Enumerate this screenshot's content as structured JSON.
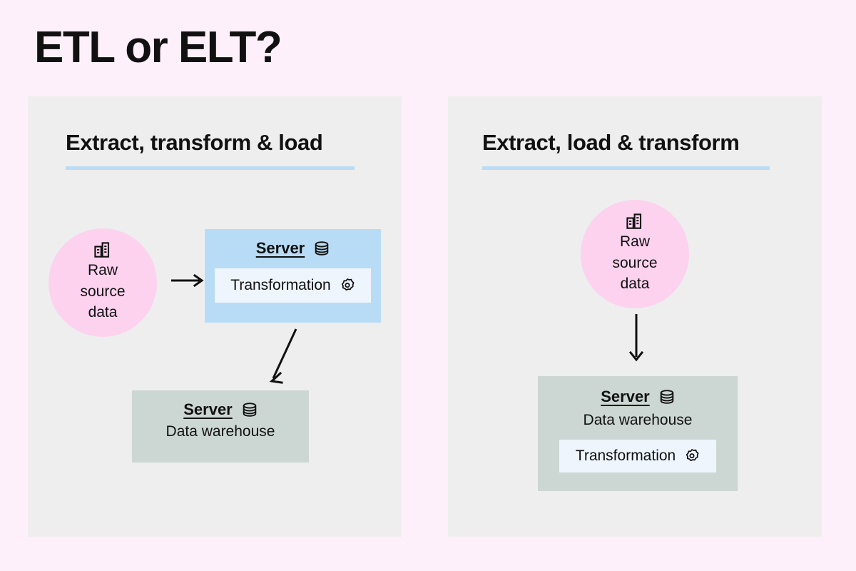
{
  "title": "ETL or ELT?",
  "colors": {
    "page_background": "#fdf0fa",
    "panel_background": "#eeeeee",
    "heading_underline": "#bcdcf5",
    "source_circle": "#fcd2ef",
    "server_blue": "#b8dcf5",
    "warehouse_grey": "#ccd6d2",
    "transform_chip": "#eef5fc",
    "text": "#111111"
  },
  "panels": [
    {
      "id": "etl",
      "heading": "Extract, transform & load",
      "source": {
        "icon": "building-icon",
        "lines": [
          "Raw",
          "source",
          "data"
        ]
      },
      "server": {
        "title": "Server",
        "title_icon": "database-icon",
        "transformation": {
          "label": "Transformation",
          "icon": "gear-icon"
        }
      },
      "warehouse": {
        "title": "Server",
        "title_icon": "database-icon",
        "subtitle": "Data warehouse"
      },
      "arrows": [
        "arrow-right",
        "arrow-diagonal-down-left"
      ]
    },
    {
      "id": "elt",
      "heading": "Extract, load & transform",
      "source": {
        "icon": "building-icon",
        "lines": [
          "Raw",
          "source",
          "data"
        ]
      },
      "warehouse": {
        "title": "Server",
        "title_icon": "database-icon",
        "subtitle": "Data warehouse",
        "transformation": {
          "label": "Transformation",
          "icon": "gear-icon"
        }
      },
      "arrows": [
        "arrow-down"
      ]
    }
  ]
}
